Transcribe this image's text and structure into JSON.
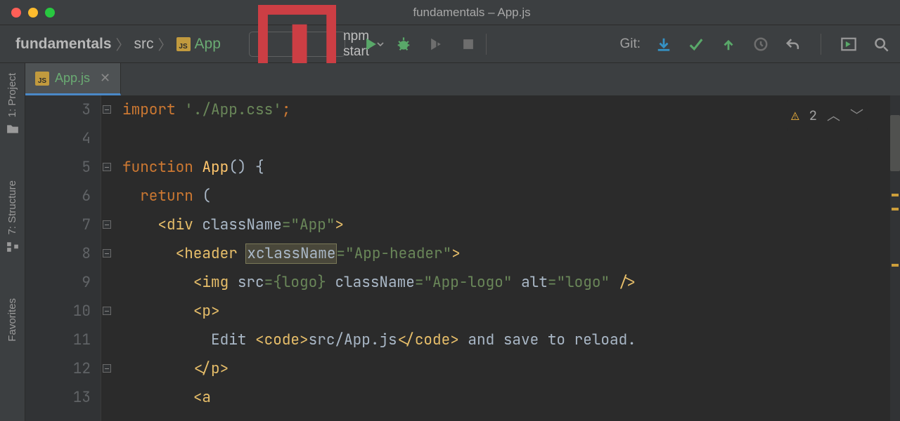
{
  "window": {
    "title": "fundamentals – App.js"
  },
  "breadcrumb": {
    "project": "fundamentals",
    "folder": "src",
    "file": "App"
  },
  "runConfig": {
    "label": "npm start"
  },
  "git": {
    "label": "Git:"
  },
  "tabs": [
    {
      "name": "App.js"
    }
  ],
  "sidebar": {
    "project": "1: Project",
    "structure": "7: Structure",
    "favorites": "Favorites"
  },
  "inspection": {
    "warnings": "2"
  },
  "gutter": [
    "3",
    "4",
    "5",
    "6",
    "7",
    "8",
    "9",
    "10",
    "11",
    "12",
    "13"
  ],
  "code": {
    "l3_kw": "import",
    "l3_str": "'./App.css'",
    "l3_semi": ";",
    "l5_kw": "function",
    "l5_name": "App",
    "l5_rest": "() {",
    "l6_kw": "return",
    "l6_paren": "(",
    "l7_open": "<div ",
    "l7_attr": "className",
    "l7_eq": "=",
    "l7_val": "\"App\"",
    "l7_close": ">",
    "l8_open": "<header ",
    "l8_xattr": "xclassName",
    "l8_eq": "=",
    "l8_val": "\"App-header\"",
    "l8_close": ">",
    "l9_open": "<img ",
    "l9_a1": "src",
    "l9_v1": "={logo} ",
    "l9_a2": "className",
    "l9_eq2": "=",
    "l9_v2": "\"App-logo\"",
    "l9_sp": " ",
    "l9_a3": "alt",
    "l9_eq3": "=",
    "l9_v3": "\"logo\"",
    "l9_close": " />",
    "l10": "<p>",
    "l11_pre": "  Edit ",
    "l11_co": "<code>",
    "l11_path": "src/App.js",
    "l11_cc": "</code>",
    "l11_post": " and save to reload.",
    "l12": "</p>",
    "l13": "<a"
  }
}
